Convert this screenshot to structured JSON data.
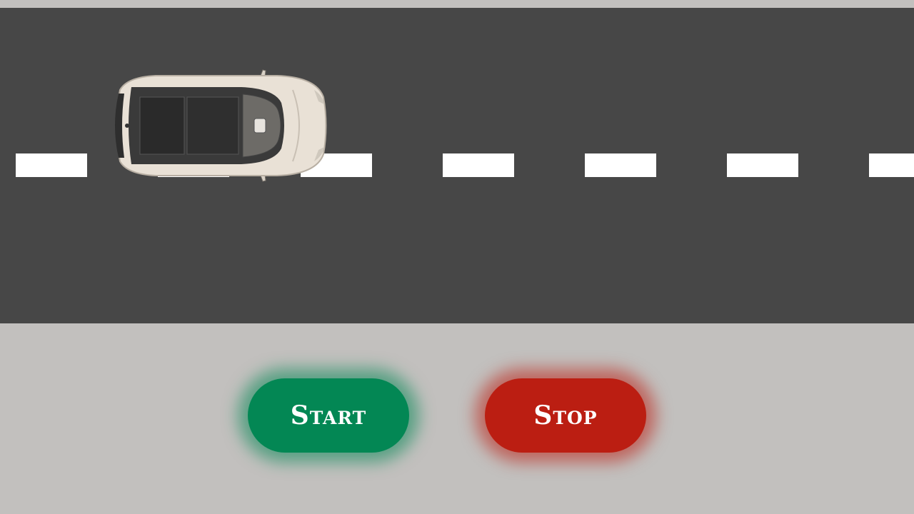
{
  "scene": {
    "road_color": "#474747",
    "lane_marking_color": "#ffffff",
    "background_color": "#c2c0be",
    "car": {
      "description_icon": "car-top-view-icon",
      "color": "#e9e1d6"
    }
  },
  "controls": {
    "start_label": "Start",
    "stop_label": "Stop",
    "start_color": "#038754",
    "stop_color": "#bb1e12"
  }
}
